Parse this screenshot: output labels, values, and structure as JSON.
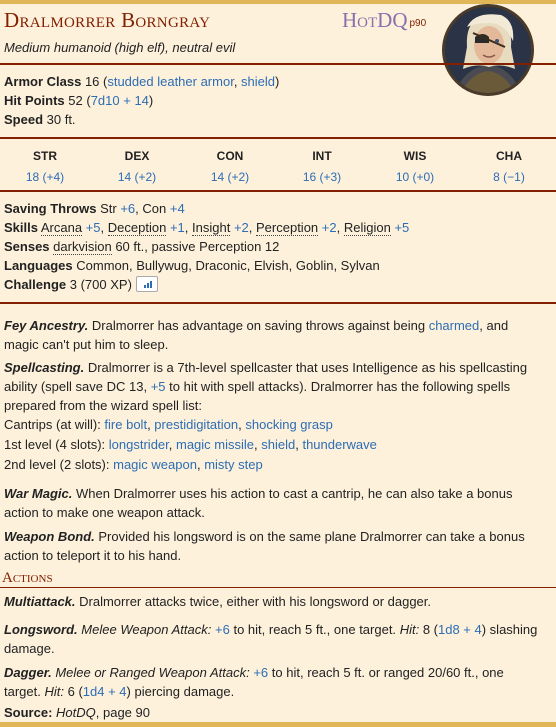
{
  "monster": {
    "name": "Dralmorrer Borngray",
    "source": "HotDQ",
    "source_page": "p90",
    "subtitle": "Medium humanoid (high elf), neutral evil"
  },
  "defense": {
    "ac_label": "Armor Class",
    "ac_value": "16 (",
    "ac_armor": "studded leather armor",
    "ac_sep": ", ",
    "ac_shield": "shield",
    "ac_close": ")",
    "hp_label": "Hit Points",
    "hp_value": "52 (",
    "hp_dice": "7d10 + 14",
    "hp_close": ")",
    "speed_label": "Speed",
    "speed_value": "30 ft."
  },
  "abilities": [
    {
      "name": "STR",
      "value": "18 (+4)"
    },
    {
      "name": "DEX",
      "value": "14 (+2)"
    },
    {
      "name": "CON",
      "value": "14 (+2)"
    },
    {
      "name": "INT",
      "value": "16 (+3)"
    },
    {
      "name": "WIS",
      "value": "10 (+0)"
    },
    {
      "name": "CHA",
      "value": "8 (−1)"
    }
  ],
  "traits": {
    "saves_label": "Saving Throws",
    "saves_str": "Str",
    "saves_str_mod": "+6",
    "saves_sep": ", Con",
    "saves_con_mod": "+4",
    "skills_label": "Skills",
    "skills": [
      {
        "name": "Arcana",
        "mod": "+5"
      },
      {
        "name": "Deception",
        "mod": "+1"
      },
      {
        "name": "Insight",
        "mod": "+2"
      },
      {
        "name": "Perception",
        "mod": "+2"
      },
      {
        "name": "Religion",
        "mod": "+5"
      }
    ],
    "senses_label": "Senses",
    "senses_dark": "darkvision",
    "senses_rest": "60 ft., passive Perception 12",
    "languages_label": "Languages",
    "languages_value": "Common, Bullywug, Draconic, Elvish, Goblin, Sylvan",
    "challenge_label": "Challenge",
    "challenge_value": "3 (700 XP)"
  },
  "features": {
    "fey_title": "Fey Ancestry.",
    "fey_text1": "Dralmorrer has advantage on saving throws against being",
    "fey_link": "charmed",
    "fey_text2": ", and magic can't put him to sleep.",
    "spell_title": "Spellcasting.",
    "spell_text1": "Dralmorrer is a 7th-level spellcaster that uses Intelligence as his spellcasting ability (spell save DC 13,",
    "spell_hit": "+5",
    "spell_text2": "to hit with spell attacks). Dralmorrer has the following spells prepared from the wizard spell list:",
    "cantrips_label": "Cantrips (at will):",
    "cantrips": [
      "fire bolt",
      "prestidigitation",
      "shocking grasp"
    ],
    "level1_label": "1st level (4 slots):",
    "level1": [
      "longstrider",
      "magic missile",
      "shield",
      "thunderwave"
    ],
    "level2_label": "2nd level (2 slots):",
    "level2": [
      "magic weapon",
      "misty step"
    ],
    "war_title": "War Magic.",
    "war_text": "When Dralmorrer uses his action to cast a cantrip, he can also take a bonus action to make one weapon attack.",
    "bond_title": "Weapon Bond.",
    "bond_text": "Provided his longsword is on the same plane Dralmorrer can take a bonus action to teleport it to his hand."
  },
  "actions": {
    "section_title": "Actions",
    "multi_title": "Multiattack.",
    "multi_text": "Dralmorrer attacks twice, either with his longsword or dagger.",
    "long_title": "Longsword.",
    "long_type": "Melee Weapon Attack:",
    "long_hit": "+6",
    "long_text1": "to hit, reach 5 ft., one target.",
    "long_hit_label": "Hit:",
    "long_dmg1": "8 (",
    "long_dice": "1d8 + 4",
    "long_dmg2": ") slashing damage.",
    "dagger_title": "Dagger.",
    "dagger_type": "Melee or Ranged Weapon Attack:",
    "dagger_hit": "+6",
    "dagger_text1": "to hit, reach 5 ft. or ranged 20/60 ft., one target.",
    "dagger_hit_label": "Hit:",
    "dagger_dmg1": "6 (",
    "dagger_dice": "1d4 + 4",
    "dagger_dmg2": ") piercing damage."
  },
  "footer": {
    "source_label": "Source:",
    "source_book": "HotDQ",
    "source_page": ", page 90"
  }
}
